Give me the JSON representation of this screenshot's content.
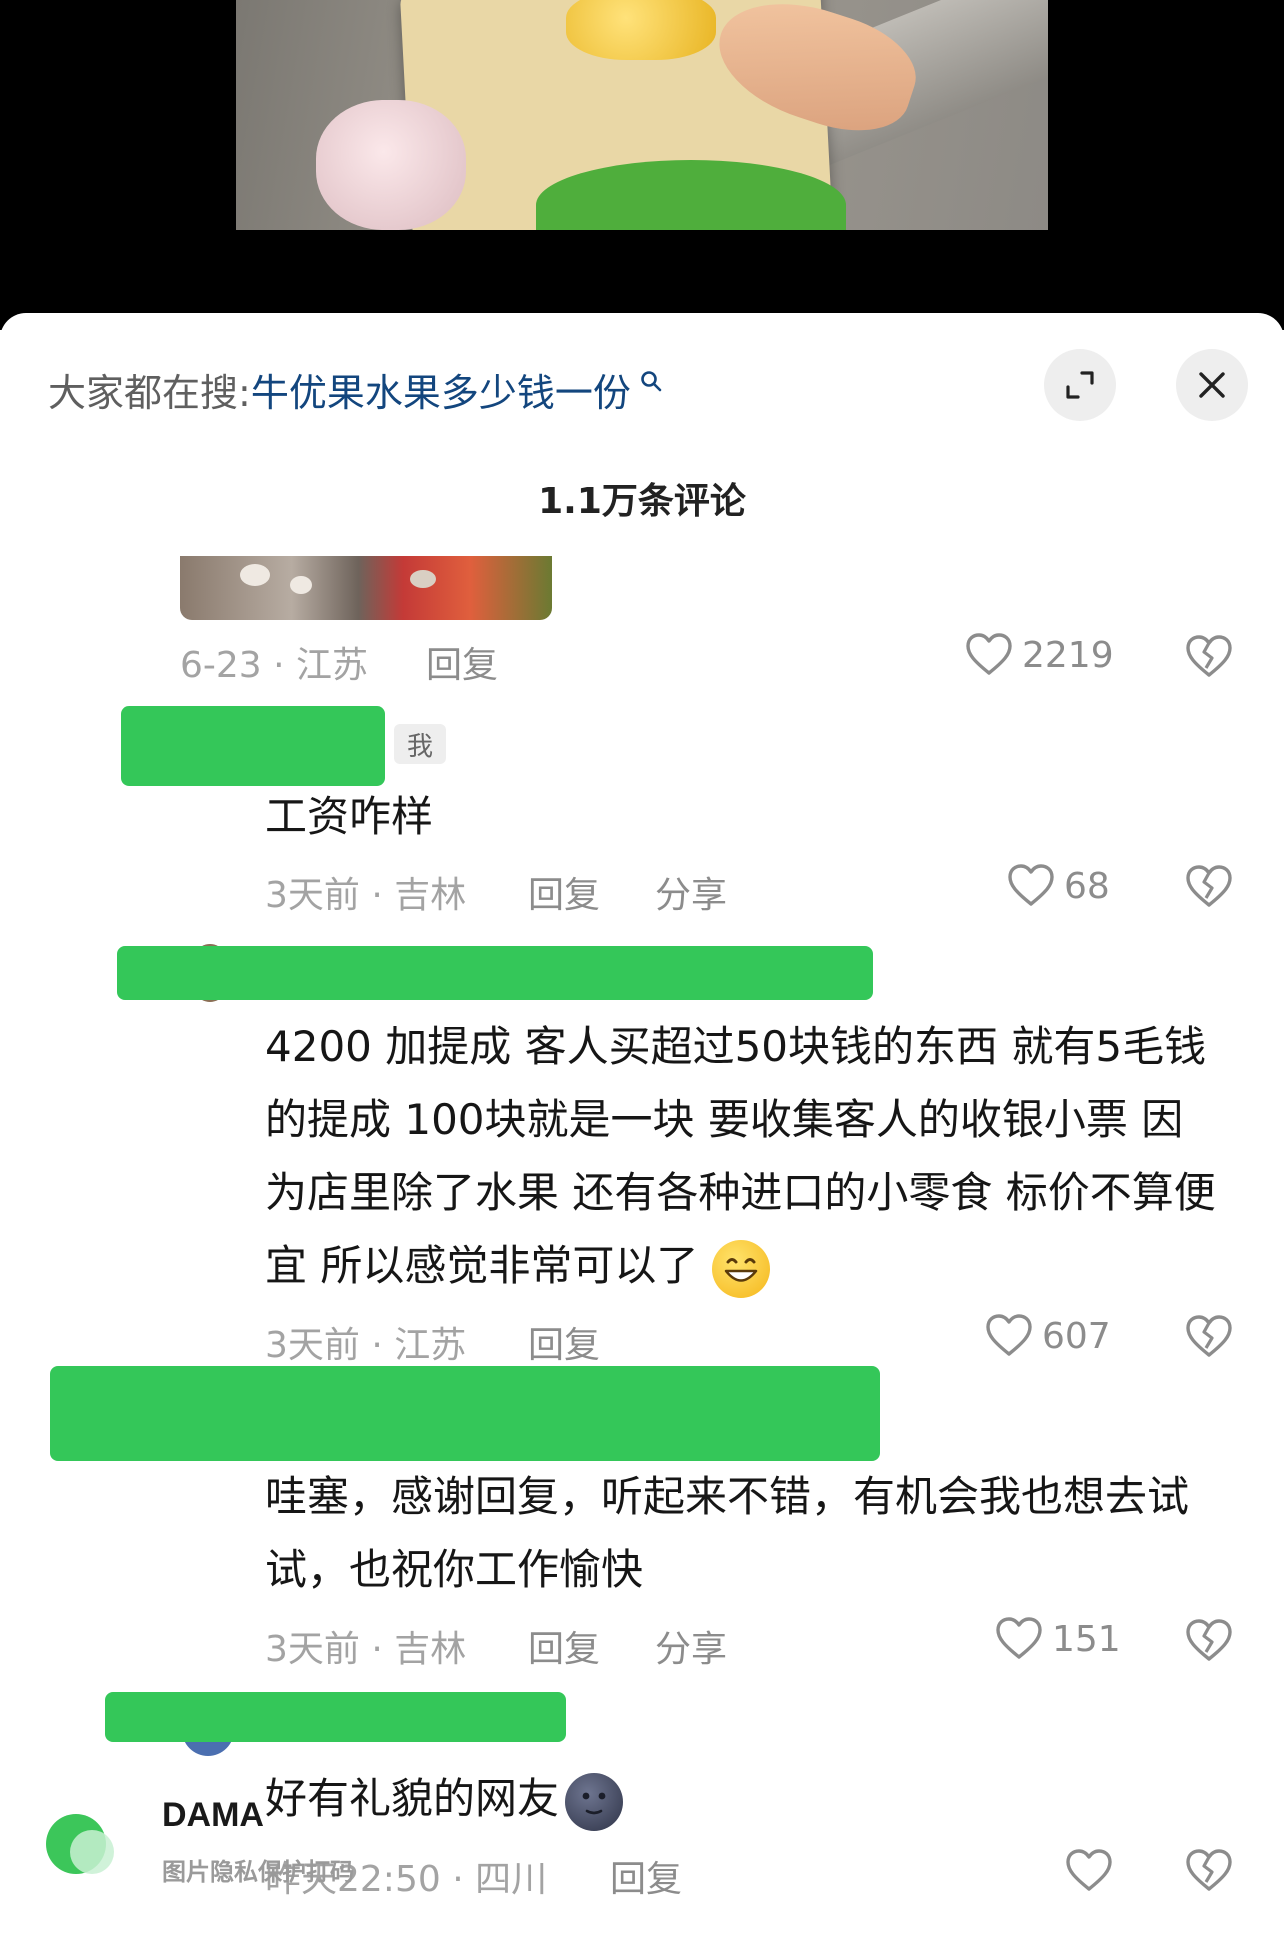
{
  "search_hint": {
    "prefix": "大家都在搜:",
    "term": "牛优果水果多少钱一份"
  },
  "sheet": {
    "comment_count": "1.1万条评论"
  },
  "comments": [
    {
      "meta": "6-23 · 江苏",
      "reply_label": "回复",
      "likes": "2219"
    },
    {
      "author_badge": "我",
      "text": "工资咋样",
      "meta": "3天前 · 吉林",
      "reply_label": "回复",
      "share_label": "分享",
      "likes": "68"
    },
    {
      "text": "4200 加提成 客人买超过50块钱的东西 就有5毛钱的提成 100块就是一块 要收集客人的收银小票 因为店里除了水果 还有各种进口的小零食 标价不算便宜 所以感觉非常可以了",
      "meta": "3天前 · 江苏",
      "reply_label": "回复",
      "likes": "607"
    },
    {
      "text": "哇塞，感谢回复，听起来不错，有机会我也想去试试，也祝你工作愉快",
      "meta": "3天前 · 吉林",
      "reply_label": "回复",
      "share_label": "分享",
      "likes": "151"
    },
    {
      "text": "好有礼貌的网友",
      "meta": "昨天22:50 · 四川",
      "reply_label": "回复",
      "likes": ""
    }
  ],
  "watermark": {
    "brand": "DAMA",
    "caption": "图片隐私保护打码"
  },
  "icons": {
    "expand": "expand-icon",
    "close": "close-icon",
    "search": "search-icon",
    "like": "heart-outline-icon",
    "dislike": "broken-heart-icon",
    "emoji_grin": "grinning-emoji",
    "emoji_moon": "new-moon-face-emoji"
  },
  "colors": {
    "search_term": "#13467e",
    "redaction": "#34c759",
    "meta_text": "#a3a3a3"
  }
}
